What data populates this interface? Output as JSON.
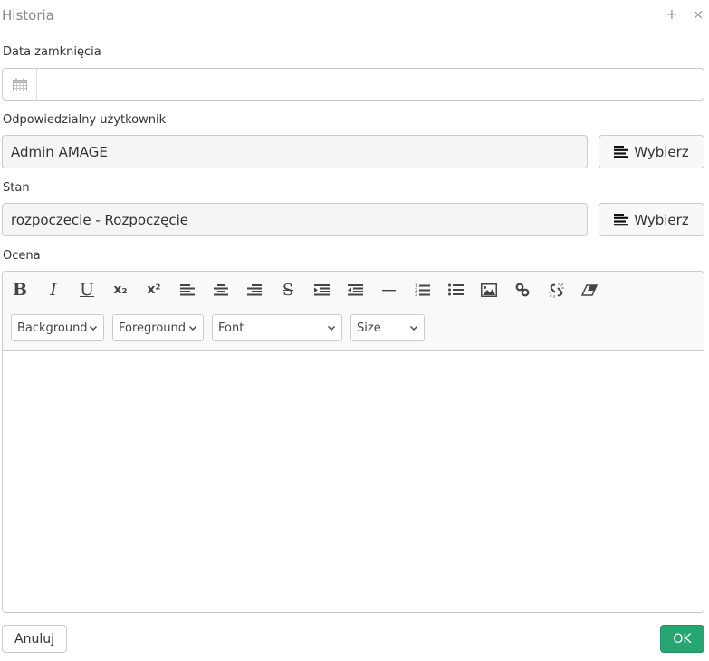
{
  "dialog": {
    "title": "Historia",
    "add_icon": "+",
    "close_icon": "×"
  },
  "fields": {
    "close_date": {
      "label": "Data zamknięcia",
      "value": "",
      "icon": "calendar-icon"
    },
    "responsible_user": {
      "label": "Odpowiedzialny użytkownik",
      "value": "Admin AMAGE",
      "button_label": "Wybierz",
      "button_icon": "list-icon"
    },
    "state": {
      "label": "Stan",
      "value": "rozpoczecie - Rozpoczęcie",
      "button_label": "Wybierz",
      "button_icon": "list-icon"
    },
    "rating": {
      "label": "Ocena",
      "content": ""
    }
  },
  "editor": {
    "toolbar_buttons": [
      {
        "name": "bold",
        "glyph": "B"
      },
      {
        "name": "italic",
        "glyph": "I"
      },
      {
        "name": "underline",
        "glyph": "U"
      },
      {
        "name": "subscript",
        "glyph": "x₂"
      },
      {
        "name": "superscript",
        "glyph": "x²"
      },
      {
        "name": "align-left",
        "glyph": ""
      },
      {
        "name": "align-center",
        "glyph": ""
      },
      {
        "name": "align-right",
        "glyph": ""
      },
      {
        "name": "strikethrough",
        "glyph": "S"
      },
      {
        "name": "indent",
        "glyph": ""
      },
      {
        "name": "outdent",
        "glyph": ""
      },
      {
        "name": "horizontal-rule",
        "glyph": ""
      },
      {
        "name": "ordered-list",
        "glyph": ""
      },
      {
        "name": "unordered-list",
        "glyph": ""
      },
      {
        "name": "image",
        "glyph": ""
      },
      {
        "name": "link",
        "glyph": ""
      },
      {
        "name": "unlink",
        "glyph": ""
      },
      {
        "name": "remove-format",
        "glyph": ""
      }
    ],
    "selects": {
      "background": "Background",
      "foreground": "Foreground",
      "font": "Font",
      "size": "Size"
    }
  },
  "footer": {
    "cancel_label": "Anuluj",
    "ok_label": "OK",
    "ok_color": "#26a472"
  }
}
